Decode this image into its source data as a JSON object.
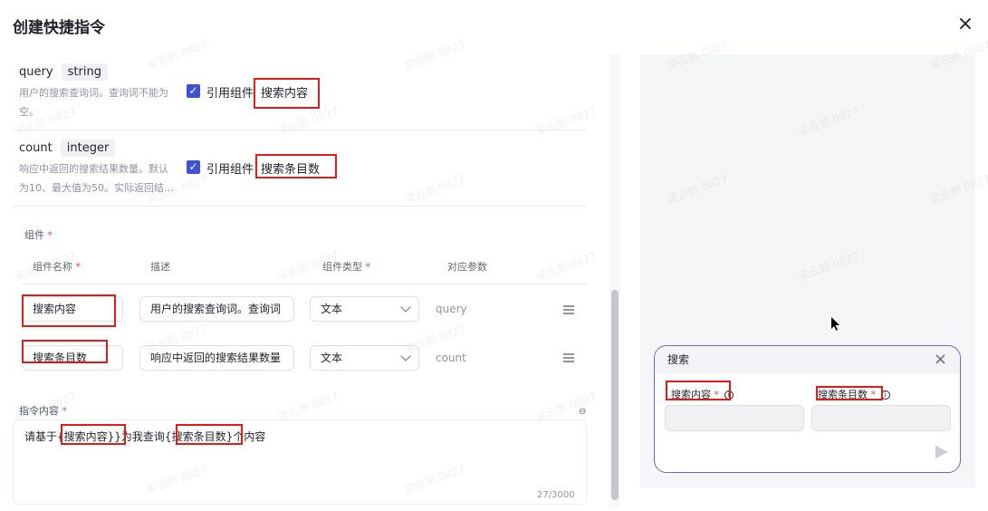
{
  "dialog": {
    "title": "创建快捷指令",
    "close_icon": "×"
  },
  "params": [
    {
      "name": "query",
      "type": "string",
      "desc_line1": "用户的搜索查询词。查询词不能为",
      "desc_line2": "空。",
      "ref_label": "引用组件",
      "ref_value": "搜索内容"
    },
    {
      "name": "count",
      "type": "integer",
      "desc_line1": "响应中返回的搜索结果数量。默认",
      "desc_line2": "为10、最大值为50。实际返回结…",
      "ref_label": "引用组件",
      "ref_value": "搜索条目数"
    }
  ],
  "components": {
    "label": "组件",
    "required_mark": "*",
    "headers": {
      "name": "组件名称",
      "desc": "描述",
      "type": "组件类型",
      "param": "对应参数"
    },
    "rows": [
      {
        "name": "搜索内容",
        "desc": "用户的搜索查询词。查询词",
        "type": "文本",
        "param": "query"
      },
      {
        "name": "搜索条目数",
        "desc": "响应中返回的搜索结果数量",
        "type": "文本",
        "param": "count"
      }
    ]
  },
  "instruction": {
    "label": "指令内容",
    "text_a": "请基于",
    "var1": "{搜索内容}}",
    "text_b": "为我查询{",
    "var2": "搜索条目数",
    "text_c": "}个内容",
    "counter": "27/3000"
  },
  "preview": {
    "card_title": "搜索",
    "field1_label": "搜索内容",
    "field2_label": "搜索条目数",
    "required_mark": "*",
    "info_mark": "i"
  },
  "watermark": "梁云鹏 0827",
  "colors": {
    "accent": "#3f51d4",
    "highlight_box": "#e21a1a",
    "card_border": "#6b64d6"
  }
}
